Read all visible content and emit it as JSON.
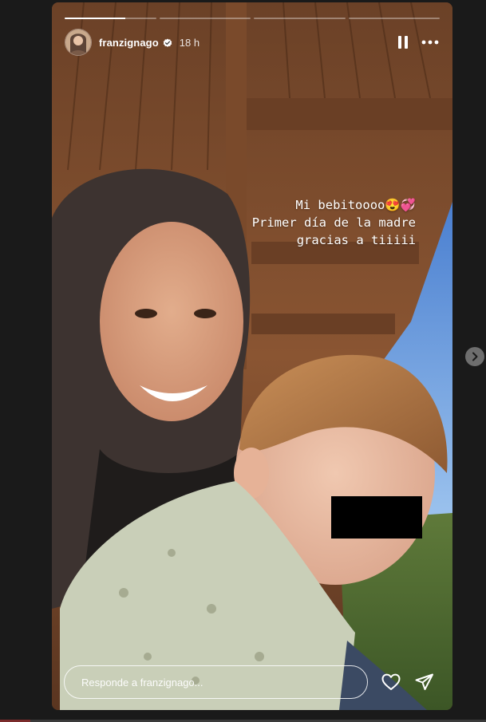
{
  "story": {
    "progress": {
      "segments": 4,
      "current_index": 0,
      "current_fraction": 0.66
    },
    "header": {
      "username": "franzignago",
      "verified": true,
      "time_ago": "18 h"
    },
    "caption": {
      "lines": [
        "Mi bebitoooo😍💞",
        "Primer día de la madre",
        "gracias a tiiiii"
      ]
    },
    "footer": {
      "reply_placeholder": "Responde a franzignago..."
    }
  },
  "colors": {
    "background": "#1a1a1a",
    "text": "#ffffff",
    "verified_badge": "#ffffff",
    "redaction": "#000000"
  },
  "icons": {
    "pause": "pause-icon",
    "more": "more-options-icon",
    "like": "heart-icon",
    "share": "send-icon",
    "next": "chevron-right-icon",
    "verified": "verified-badge-icon"
  }
}
